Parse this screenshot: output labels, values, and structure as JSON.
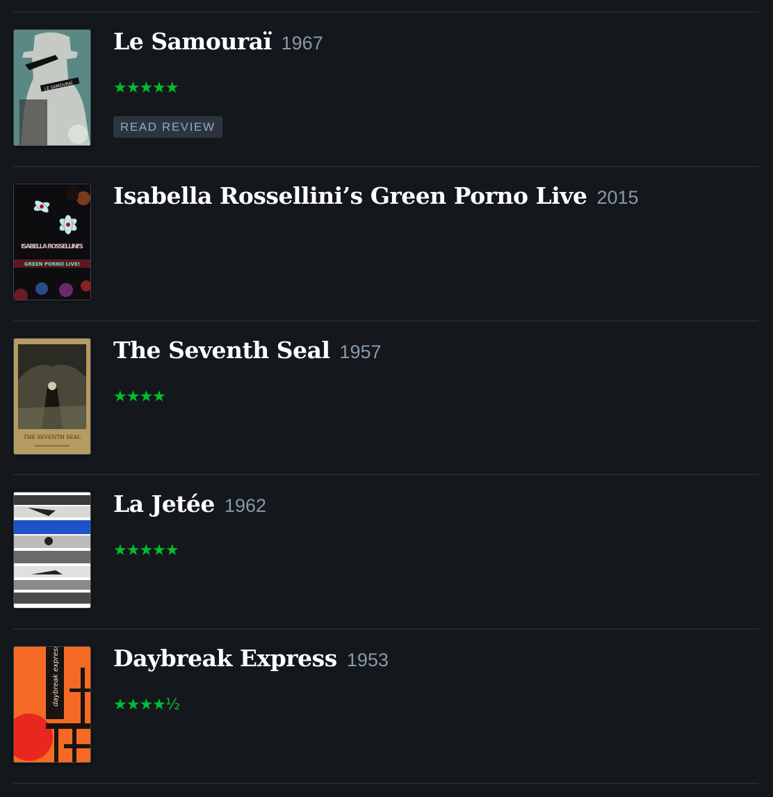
{
  "films": [
    {
      "title": "Le Samouraï",
      "year": "1967",
      "rating": "★★★★★",
      "poster_text": "LE SAMOURAÏ",
      "action": "READ REVIEW"
    },
    {
      "title": "Isabella Rossellini’s Green Porno Live",
      "year": "2015",
      "rating": "",
      "poster_text": "ISABELLA ROSSELLINI'S",
      "poster_subtext": "GREEN PORNO LIVE!"
    },
    {
      "title": "The Seventh Seal",
      "year": "1957",
      "rating": "★★★★",
      "poster_text": "THE SEVENTH SEAL"
    },
    {
      "title": "La Jetée",
      "year": "1962",
      "rating": "★★★★★"
    },
    {
      "title": "Daybreak Express",
      "year": "1953",
      "rating": "★★★★½",
      "poster_text": "daybreak express"
    }
  ],
  "colors": {
    "background": "#14181c",
    "title": "#ffffff",
    "year": "#8899aa",
    "star": "#00c030",
    "divider": "#2c3440"
  }
}
